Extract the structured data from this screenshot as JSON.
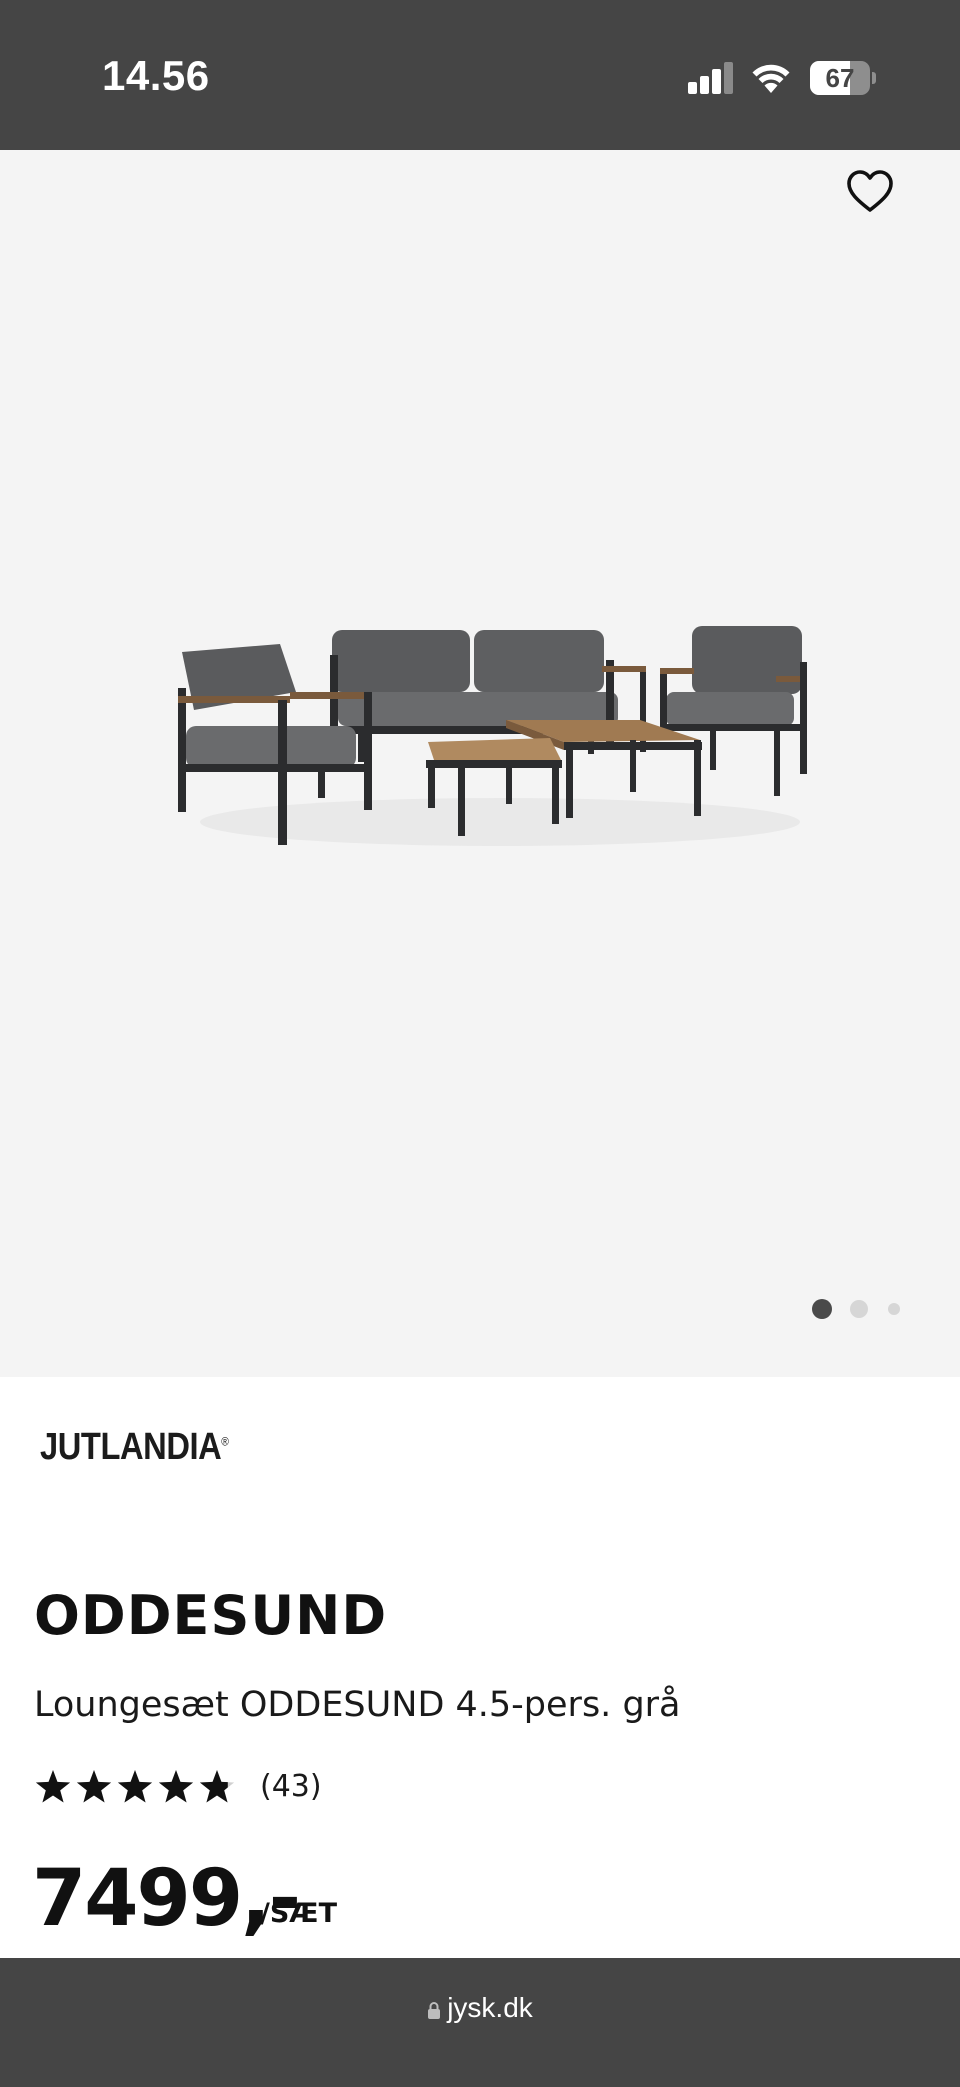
{
  "status_bar": {
    "time": "14.56",
    "battery": "67",
    "battery_level": 0.67,
    "signal_bars": 3
  },
  "product_image": {
    "favorite_icon": "heart-outline-icon",
    "carousel": {
      "total": 3,
      "active": 1
    }
  },
  "product": {
    "brand": "JUTLANDIA",
    "brand_mark": "®",
    "name": "ODDESUND",
    "subtitle": "Loungesæt ODDESUND 4.5-pers. grå",
    "rating": {
      "stars": 4.8,
      "max": 5,
      "count": "(43)"
    },
    "price": "7499,-",
    "price_unit": "/SÆT"
  },
  "browser": {
    "url": "jysk.dk",
    "lock_icon": "lock-icon"
  },
  "colors": {
    "chrome": "#454545",
    "image_bg": "#f4f4f4",
    "text": "#111111"
  }
}
